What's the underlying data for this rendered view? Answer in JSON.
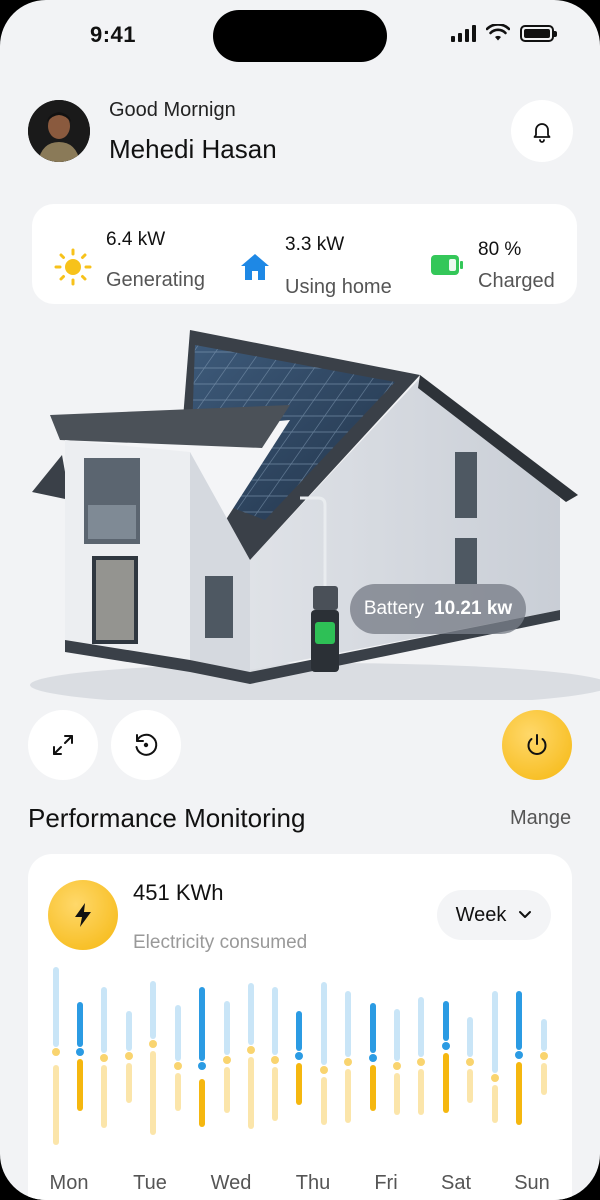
{
  "status_bar": {
    "time": "9:41"
  },
  "header": {
    "greeting": "Good Mornign",
    "name": "Mehedi Hasan"
  },
  "stats": [
    {
      "value": "6.4 kW",
      "label": "Generating",
      "icon": "sun-icon",
      "color": "#f7c21b"
    },
    {
      "value": "3.3 kW",
      "label": "Using home",
      "icon": "home-icon",
      "color": "#1e88e5"
    },
    {
      "value": "80 %",
      "label": "Charged",
      "icon": "battery-icon",
      "color": "#34c759"
    }
  ],
  "battery_badge": {
    "label": "Battery",
    "value": "10.21 kw"
  },
  "performance": {
    "title": "Performance Monitoring",
    "manage_label": "Mange",
    "energy_value": "451 KWh",
    "energy_label": "Electricity consumed",
    "period": "Week",
    "days": [
      "Mon",
      "Tue",
      "Wed",
      "Thu",
      "Fri",
      "Sat",
      "Sun"
    ]
  },
  "colors": {
    "accent_yellow": "#f5b70f",
    "accent_blue": "#2b9be3",
    "background": "#f2f3f5"
  }
}
